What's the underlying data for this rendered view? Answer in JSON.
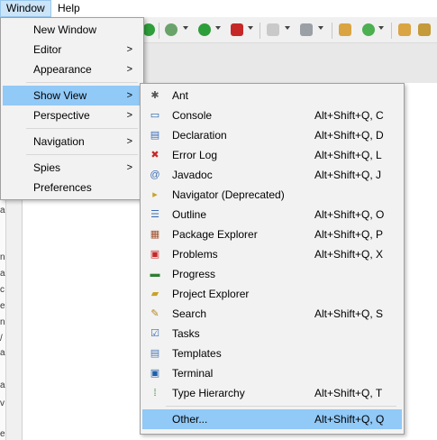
{
  "menubar": {
    "window_label": "Window",
    "help_label": "Help"
  },
  "window_menu": {
    "items": [
      {
        "label": "New Window",
        "has_submenu": false
      },
      {
        "label": "Editor",
        "has_submenu": true
      },
      {
        "label": "Appearance",
        "has_submenu": true
      },
      {
        "label": "Show View",
        "has_submenu": true
      },
      {
        "label": "Perspective",
        "has_submenu": true
      },
      {
        "label": "Navigation",
        "has_submenu": true
      },
      {
        "label": "Spies",
        "has_submenu": true
      },
      {
        "label": "Preferences",
        "has_submenu": false
      }
    ],
    "submenu_arrow": ">"
  },
  "show_view_menu": {
    "items": [
      {
        "label": "Ant",
        "accel": "",
        "icon": "ant-icon",
        "glyph": "✱",
        "color": "#555555"
      },
      {
        "label": "Console",
        "accel": "Alt+Shift+Q, C",
        "icon": "console-icon",
        "glyph": "▭",
        "color": "#1f5fa8"
      },
      {
        "label": "Declaration",
        "accel": "Alt+Shift+Q, D",
        "icon": "declaration-icon",
        "glyph": "▤",
        "color": "#3a6cb5"
      },
      {
        "label": "Error Log",
        "accel": "Alt+Shift+Q, L",
        "icon": "error-log-icon",
        "glyph": "✖",
        "color": "#c62828"
      },
      {
        "label": "Javadoc",
        "accel": "Alt+Shift+Q, J",
        "icon": "javadoc-icon",
        "glyph": "@",
        "color": "#3a6cb5"
      },
      {
        "label": "Navigator (Deprecated)",
        "accel": "",
        "icon": "navigator-icon",
        "glyph": "▸",
        "color": "#c9a227"
      },
      {
        "label": "Outline",
        "accel": "Alt+Shift+Q, O",
        "icon": "outline-icon",
        "glyph": "☰",
        "color": "#3a6cb5"
      },
      {
        "label": "Package Explorer",
        "accel": "Alt+Shift+Q, P",
        "icon": "package-explorer-icon",
        "glyph": "▦",
        "color": "#a0522d"
      },
      {
        "label": "Problems",
        "accel": "Alt+Shift+Q, X",
        "icon": "problems-icon",
        "glyph": "▣",
        "color": "#c62828"
      },
      {
        "label": "Progress",
        "accel": "",
        "icon": "progress-icon",
        "glyph": "▬",
        "color": "#2e7d32"
      },
      {
        "label": "Project Explorer",
        "accel": "",
        "icon": "project-explorer-icon",
        "glyph": "▰",
        "color": "#c9a227"
      },
      {
        "label": "Search",
        "accel": "Alt+Shift+Q, S",
        "icon": "search-icon",
        "glyph": "✎",
        "color": "#b8860b"
      },
      {
        "label": "Tasks",
        "accel": "",
        "icon": "tasks-icon",
        "glyph": "☑",
        "color": "#3a6cb5"
      },
      {
        "label": "Templates",
        "accel": "",
        "icon": "templates-icon",
        "glyph": "▤",
        "color": "#4a7ab8"
      },
      {
        "label": "Terminal",
        "accel": "",
        "icon": "terminal-icon",
        "glyph": "▣",
        "color": "#1f5fa8"
      },
      {
        "label": "Type Hierarchy",
        "accel": "Alt+Shift+Q, T",
        "icon": "type-hierarchy-icon",
        "glyph": "⁞",
        "color": "#2e7d32"
      },
      {
        "label": "Other...",
        "accel": "Alt+Shift+Q, Q",
        "icon": "",
        "glyph": "",
        "color": ""
      }
    ],
    "highlight_color": "#91c9f7"
  },
  "left_strip_chars": [
    "a",
    "n",
    "a",
    "c",
    "e",
    "n",
    "/",
    "a",
    "a",
    "v",
    "e"
  ]
}
